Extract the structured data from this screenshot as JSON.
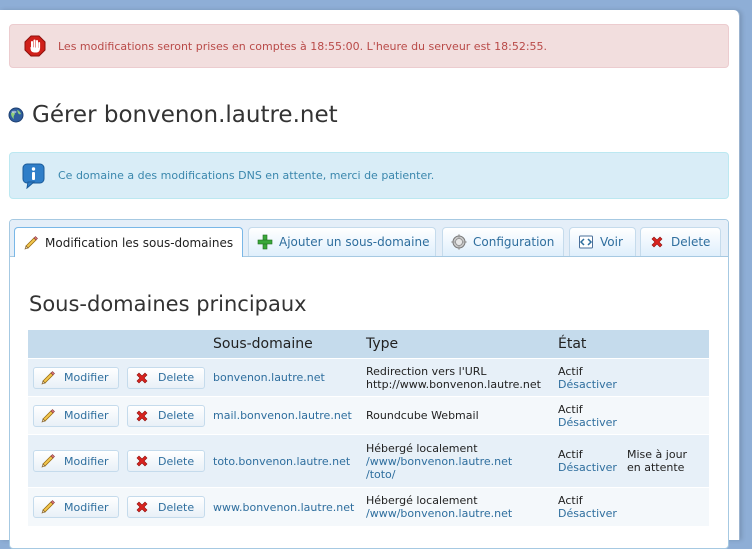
{
  "notice": {
    "text": "Les modifications seront prises en comptes à 18:55:00. L'heure du serveur est 18:52:55.",
    "icon": "stop-hand-icon"
  },
  "page_title": "Gérer bonvenon.lautre.net",
  "info": {
    "text": "Ce domaine a des modifications DNS en attente, merci de patienter.",
    "icon": "info-icon"
  },
  "tabs": [
    {
      "label": "Modification les sous-domaines",
      "icon": "pencil-icon",
      "active": true
    },
    {
      "label": "Ajouter un sous-domaine",
      "icon": "plus-icon",
      "active": false
    },
    {
      "label": "Configuration",
      "icon": "gear-icon",
      "active": false
    },
    {
      "label": "Voir",
      "icon": "view-icon",
      "active": false
    },
    {
      "label": "Delete",
      "icon": "delete-icon",
      "active": false
    }
  ],
  "section_title": "Sous-domaines principaux",
  "table": {
    "headers": {
      "subdomain": "Sous-domaine",
      "type": "Type",
      "state": "État"
    },
    "modify_label": "Modifier",
    "delete_label": "Delete",
    "rows": [
      {
        "subdomain": "bonvenon.lautre.net",
        "type_line1": "Redirection vers l'URL",
        "type_line2": "http://www.bonvenon.lautre.net",
        "state": "Actif",
        "state_action": "Désactiver",
        "note_line1": "",
        "note_line2": ""
      },
      {
        "subdomain": "mail.bonvenon.lautre.net",
        "type_line1": "Roundcube Webmail",
        "type_line2": "",
        "state": "Actif",
        "state_action": "Désactiver",
        "note_line1": "",
        "note_line2": ""
      },
      {
        "subdomain": "toto.bonvenon.lautre.net",
        "type_line1": "Hébergé localement",
        "type_line2": "/www/bonvenon.lautre.net",
        "type_line3": "/toto/",
        "state": "Actif",
        "state_action": "Désactiver",
        "note_line1": "Mise à jour",
        "note_line2": "en attente"
      },
      {
        "subdomain": "www.bonvenon.lautre.net",
        "type_line1": "Hébergé localement",
        "type_line2": "/www/bonvenon.lautre.net",
        "state": "Actif",
        "state_action": "Désactiver",
        "note_line1": "",
        "note_line2": ""
      }
    ]
  },
  "colors": {
    "error_bg": "#f2dede",
    "error_text": "#b94a48",
    "info_bg": "#d9edf7",
    "info_text": "#3a87ad",
    "link": "#2e6e9e",
    "header_bg": "#c5dbec"
  }
}
